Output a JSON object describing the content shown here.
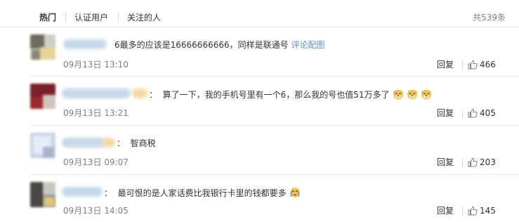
{
  "tabs": [
    {
      "label": "热门"
    },
    {
      "label": "认证用户"
    },
    {
      "label": "关注的人"
    }
  ],
  "total": "共539条",
  "reply_label": "回复",
  "comments": [
    {
      "separator": "",
      "text": "6最多的应该是16666666666，同样是联通号 ",
      "link": "评论配图",
      "time": "09月13日 13:10",
      "likes": "466",
      "emoji": []
    },
    {
      "separator": "：",
      "text": "算了一下，我的手机号里有一个6，那么我的号也值51万多了",
      "link": "",
      "time": "09月13日 13:21",
      "likes": "405",
      "emoji": [
        "doge-icon",
        "doge-icon",
        "doge-icon"
      ]
    },
    {
      "separator": "：",
      "text": "智商税",
      "link": "",
      "time": "09月13日 09:07",
      "likes": "203",
      "emoji": []
    },
    {
      "separator": "：",
      "text": "最可恨的是人家话费比我银行卡里的钱都要多",
      "link": "",
      "time": "09月13日 14:05",
      "likes": "145",
      "emoji": [
        "crying-icon"
      ]
    }
  ],
  "colors": {
    "link": "#5b8fc9",
    "muted": "#808080",
    "text": "#333333"
  }
}
